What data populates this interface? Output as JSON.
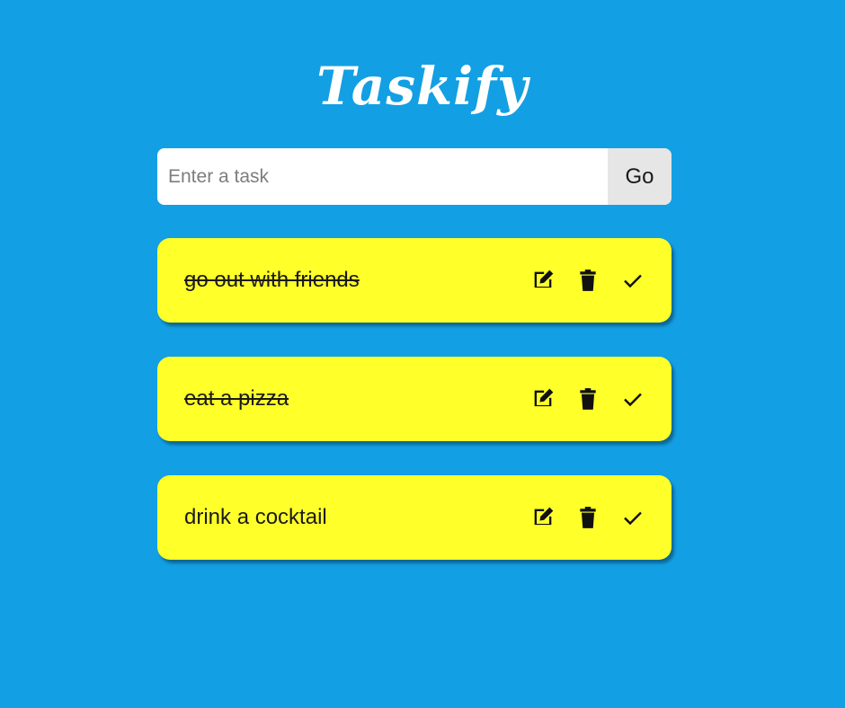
{
  "header": {
    "title": "Taskify"
  },
  "form": {
    "input_placeholder": "Enter a task",
    "input_value": "",
    "submit_label": "Go"
  },
  "tasks": [
    {
      "text": "go out with friends",
      "done": true
    },
    {
      "text": "eat a pizza",
      "done": true
    },
    {
      "text": "drink a cocktail",
      "done": false
    }
  ],
  "icons": {
    "edit": "edit-icon",
    "delete": "trash-icon",
    "complete": "check-icon"
  },
  "colors": {
    "background": "#139fe3",
    "card": "#ffff2a",
    "button": "#e6e6e6"
  }
}
